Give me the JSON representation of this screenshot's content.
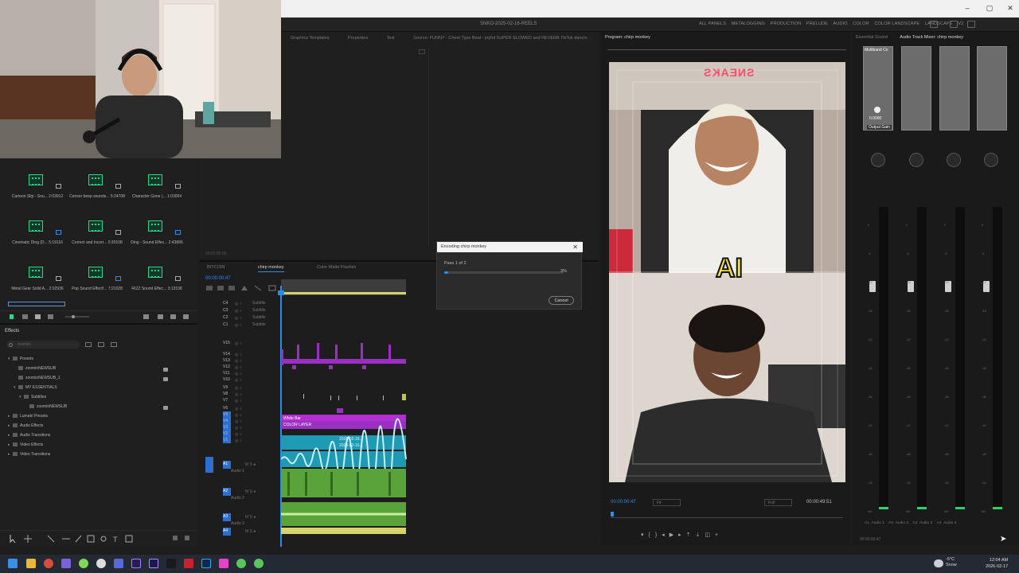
{
  "project_title": "SNKO-2025-02-16-REELS",
  "workspaces": [
    "ALL PANELS",
    "METALOGGING",
    "PRODUCTION",
    "PRELUDE",
    "AUDIO",
    "COLOR",
    "COLOR LANDSCAPE",
    "LANDSCAPE",
    "V2"
  ],
  "bin": {
    "clips": [
      {
        "name": "Cartoon Slip - Sou...",
        "dur": "2:03912"
      },
      {
        "name": "Censor beep sounds...",
        "dur": "5:24708"
      },
      {
        "name": "Character Gone (...",
        "dur": "1:03004"
      },
      {
        "name": "Cinematic Ding (D...",
        "dur": "5:19116"
      },
      {
        "name": "Correct and Incorr...",
        "dur": "0:30108"
      },
      {
        "name": "Ding - Sound Effec...",
        "dur": "2:43896"
      },
      {
        "name": "Metal Gear Solid A...",
        "dur": "2:02936"
      },
      {
        "name": "Pop Sound Effect!...",
        "dur": "7:21028"
      },
      {
        "name": "RIZZ Sound Effec...",
        "dur": "3:13108"
      }
    ]
  },
  "effects": {
    "title": "Effects",
    "search_placeholder": "zoomin",
    "tree": [
      {
        "label": "Presets",
        "indent": 0,
        "arrow": "▾",
        "lock": false
      },
      {
        "label": "zoominNEWSUB",
        "indent": 1,
        "arrow": "",
        "lock": true
      },
      {
        "label": "zoominNEWSUB_1",
        "indent": 1,
        "arrow": "",
        "lock": true
      },
      {
        "label": "MY ESSENTIALS",
        "indent": 1,
        "arrow": "▾",
        "lock": false
      },
      {
        "label": "Subtitles",
        "indent": 2,
        "arrow": "▾",
        "lock": false
      },
      {
        "label": "zoominNEWSUB",
        "indent": 3,
        "arrow": "",
        "lock": true
      },
      {
        "label": "Lumetri Presets",
        "indent": 0,
        "arrow": "▸",
        "lock": false
      },
      {
        "label": "Audio Effects",
        "indent": 0,
        "arrow": "▸",
        "lock": false
      },
      {
        "label": "Audio Transitions",
        "indent": 0,
        "arrow": "▸",
        "lock": false
      },
      {
        "label": "Video Effects",
        "indent": 0,
        "arrow": "▸",
        "lock": false
      },
      {
        "label": "Video Transitions",
        "indent": 0,
        "arrow": "▸",
        "lock": false
      }
    ]
  },
  "source_tabs": [
    "Graphics Templates",
    "Properties",
    "Text",
    "Source: FUNNY - Chem Type Beat - joyful  SUPER SLOWED and REVERB  TikTok dancin"
  ],
  "source_timecode": "00:00:00:00",
  "timeline": {
    "tabs": [
      "BITCOIN",
      "chirp monkey",
      "Color Matte Flashes"
    ],
    "active_tab": "chirp monkey",
    "timecode": "00:00:00:47",
    "tracks": [
      {
        "label": "C4",
        "name": "Subtitle"
      },
      {
        "label": "C3",
        "name": "Subtitle"
      },
      {
        "label": "C2",
        "name": "Subtitle"
      },
      {
        "label": "C1",
        "name": "Subtitle"
      },
      {
        "label": "V15",
        "name": ""
      },
      {
        "label": "V14",
        "name": ""
      },
      {
        "label": "V13",
        "name": ""
      },
      {
        "label": "V12",
        "name": ""
      },
      {
        "label": "V11",
        "name": ""
      },
      {
        "label": "V10",
        "name": ""
      },
      {
        "label": "V9",
        "name": ""
      },
      {
        "label": "V8",
        "name": ""
      },
      {
        "label": "V7",
        "name": ""
      },
      {
        "label": "V6",
        "name": ""
      },
      {
        "label": "V5",
        "name": ""
      },
      {
        "label": "V4",
        "name": ""
      },
      {
        "label": "V3",
        "name": ""
      },
      {
        "label": "V2",
        "name": ""
      },
      {
        "label": "V1",
        "name": ""
      }
    ],
    "audio_tracks": [
      {
        "label": "A1",
        "name": "Audio 1"
      },
      {
        "label": "A2",
        "name": "Audio 2"
      },
      {
        "label": "A3",
        "name": "Audio 3"
      },
      {
        "label": "A4",
        "name": ""
      }
    ],
    "clip_white_bar": "White Bar",
    "clip_color_layer": "COLOR LAYER",
    "clip_date_1": "2026-02-16...",
    "clip_date_2": "2026-02-16..."
  },
  "dialog": {
    "title": "Encoding chirp monkey",
    "pass": "Pass 1 of 2",
    "percent": "3%",
    "progress": 0.03,
    "cancel": "Cancel"
  },
  "program": {
    "title": "Program: chirp monkey",
    "timecode": "00:00:00:47",
    "duration": "00:00:49:51",
    "fit": "Fit",
    "full": "Full",
    "overlay_text": "AI",
    "neon_sign": "SNEAKS"
  },
  "mixer": {
    "tabs": [
      "Essential Sound",
      "Audio Track Mixer: chirp monkey"
    ],
    "strip_label": "Multiband Co",
    "output_label": "Output Gain",
    "output_value": "0.0000",
    "channels": [
      "A1",
      "Audio 1",
      "A2",
      "Audio 2",
      "A3",
      "Audio 3",
      "A4",
      "Audio 4"
    ],
    "scale": [
      "0",
      "-6",
      "-12",
      "-18",
      "-24",
      "-30",
      "-36",
      "-42",
      "-48",
      "-54",
      "dB"
    ],
    "bottom_timecode": "00:00:00:47"
  },
  "taskbar": {
    "weather_temp": "-5°C",
    "weather_text": "Snow",
    "time": "12:04 AM",
    "date": "2026-02-17"
  },
  "colors": {
    "accent": "#2d8ceb",
    "audio_green": "#2fd58a",
    "video_purple": "#9b2fc4",
    "clip_magenta": "#b32dd1",
    "clip_cyan": "#1f9ab5"
  }
}
